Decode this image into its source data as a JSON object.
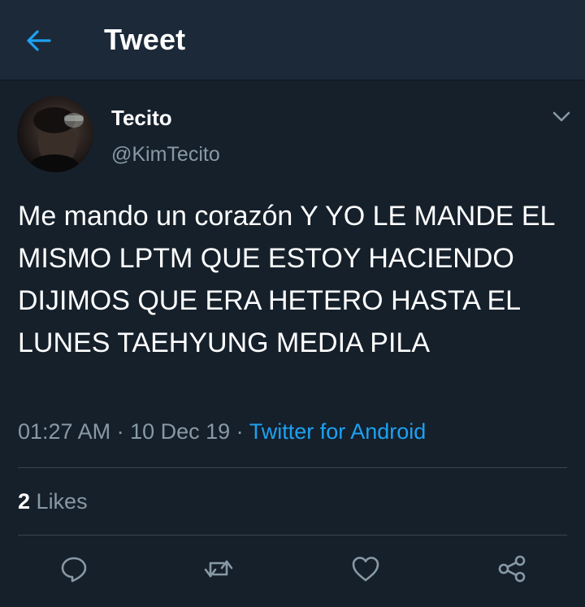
{
  "header": {
    "title": "Tweet",
    "back_icon": "arrow-left-icon",
    "accent_color": "#1da1f2"
  },
  "tweet": {
    "author": {
      "name": "Tecito",
      "handle": "@KimTecito"
    },
    "text": "Me mando un corazón Y YO LE MANDE EL MISMO LPTM QUE ESTOY HACIENDO DIJIMOS QUE ERA HETERO HASTA EL LUNES TAEHYUNG MEDIA PILA",
    "time": "01:27 AM",
    "sep1": " · ",
    "date": "10 Dec 19",
    "sep2": " · ",
    "source": "Twitter for Android",
    "likes_count": "2",
    "likes_label": "Likes"
  },
  "actions": [
    {
      "name": "reply",
      "icon": "reply-icon"
    },
    {
      "name": "retweet",
      "icon": "retweet-icon"
    },
    {
      "name": "like",
      "icon": "heart-icon"
    },
    {
      "name": "share",
      "icon": "share-icon"
    }
  ],
  "colors": {
    "background": "#15202b",
    "header_background": "#1c2938",
    "muted_text": "#8899a6",
    "divider": "#38444d"
  }
}
